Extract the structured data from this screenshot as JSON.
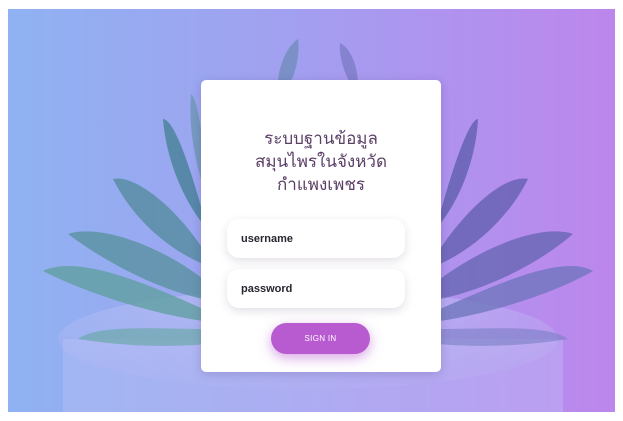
{
  "login": {
    "title_lines": [
      "ระบบฐานข้อมูล",
      "สมุนไพรในจังหวัด",
      "กำแพงเพชร"
    ],
    "username_placeholder": "username",
    "password_placeholder": "password",
    "signin_label": "SIGN IN"
  },
  "background": {
    "image": "succulent-plant-in-pot",
    "gradient_left": "#8fb2f2",
    "gradient_right": "#bd86ec"
  },
  "colors": {
    "title": "#5a3f66",
    "button": "#b85bd0",
    "card": "#ffffff"
  }
}
